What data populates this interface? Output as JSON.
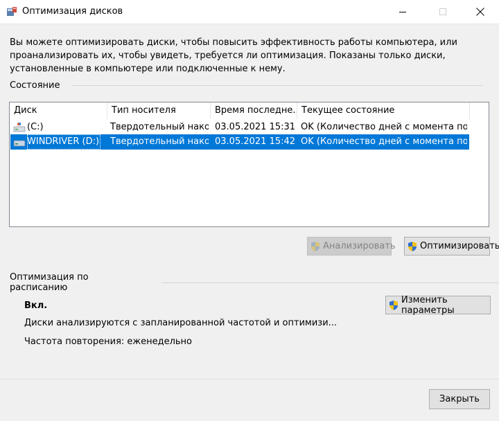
{
  "window": {
    "title": "Оптимизация дисков"
  },
  "description": "Вы можете оптимизировать диски, чтобы повысить эффективность работы  компьютера, или проанализировать их, чтобы увидеть, требуется ли оптимизация. Показаны только диски, установленные в компьютере или подключенные к нему.",
  "status_section": {
    "title": "Состояние",
    "columns": [
      "Диск",
      "Тип носителя",
      "Время последне...",
      "Текущее состояние"
    ],
    "rows": [
      {
        "drive": "(C:)",
        "media": "Твердотельный нако...",
        "time": "03.05.2021 15:31",
        "state": "OK (Количество дней с момента пос..."
      },
      {
        "drive": "WINDRIVER (D:)",
        "media": "Твердотельный нако...",
        "time": "03.05.2021 15:42",
        "state": "OK (Количество дней с момента пос..."
      }
    ],
    "selected_row": 1
  },
  "buttons": {
    "analyze": "Анализировать",
    "optimize": "Оптимизировать",
    "change_settings": "Изменить параметры",
    "close": "Закрыть"
  },
  "schedule_section": {
    "title": "Оптимизация по расписанию",
    "state": "Вкл.",
    "info": "Диски анализируются с запланированной частотой и оптимизи...",
    "frequency": "Частота повторения: еженедельно"
  },
  "colors": {
    "selection": "#0078d7",
    "window_bg": "#f0f0f0"
  },
  "icons": {
    "app": "defrag-icon",
    "drive": "drive-icon",
    "uac": "uac-shield-icon"
  }
}
